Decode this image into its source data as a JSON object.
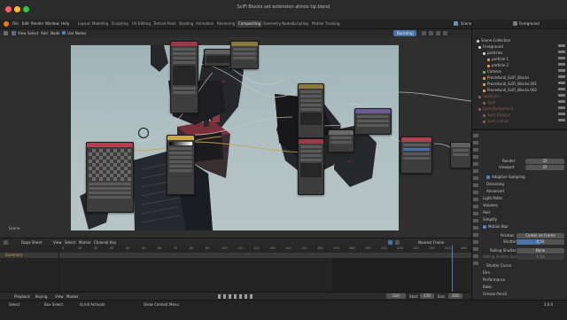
{
  "window": {
    "title": "SciFi Blocks set extension atmos tip.blend",
    "traffic_lights": [
      "#ff5f57",
      "#febc2e",
      "#28c840"
    ]
  },
  "menubar": {
    "menus": [
      "File",
      "Edit",
      "Render",
      "Window",
      "Help"
    ],
    "workspaces": [
      "Layout",
      "Modeling",
      "Sculpting",
      "UV Editing",
      "Texture Paint",
      "Shading",
      "Animation",
      "Rendering",
      "Compositing",
      "Geometry Nodes",
      "Scripting",
      "Motion Tracking"
    ],
    "active_workspace": "Compositing",
    "scene": "Scene",
    "view_layer": "Foreground"
  },
  "editor_header": {
    "items": [
      "View",
      "Select",
      "Add",
      "Node"
    ],
    "use_nodes": "Use Nodes",
    "backdrop": "Backdrop"
  },
  "outliner": {
    "title": "Scene Collection",
    "rows": [
      {
        "label": "Foreground",
        "color": "#cfcfcf"
      },
      {
        "label": "particles",
        "color": "#cfcfcf"
      },
      {
        "label": "particle 1",
        "color": "#cfcfcf"
      },
      {
        "label": "particle 2",
        "color": "#cfcfcf"
      },
      {
        "label": "Camera",
        "color": "#cfcfcf"
      },
      {
        "label": "Procedural_SciFi_Blocks",
        "color": "#cfcfcf"
      },
      {
        "label": "Procedural_SciFi_Blocks.001",
        "color": "#cfcfcf"
      },
      {
        "label": "Procedural_SciFi_Blocks.002",
        "color": "#cfcfcf"
      },
      {
        "label": "Spotlights",
        "color": "#8a5a5a"
      },
      {
        "label": "Spot",
        "color": "#8a5a5a"
      },
      {
        "label": "Spot Background",
        "color": "#8a5a5a"
      },
      {
        "label": "Spot_Emptys",
        "color": "#8a5a5a"
      },
      {
        "label": "Spot_Lamps",
        "color": "#8a5a5a"
      }
    ]
  },
  "properties": {
    "render_label": "Render",
    "render_value": "32",
    "viewport_label": "Viewport",
    "viewport_value": "32",
    "adaptive_sampling": "Adaptive Sampling",
    "denoising": "Denoising",
    "advanced": "Advanced",
    "light_paths": "Light Paths",
    "volumes": "Volumes",
    "hair": "Hair",
    "simplify": "Simplify",
    "motion_blur": "Motion Blur",
    "position_label": "Position",
    "position_value": "Center on Frame",
    "shutter_label": "Shutter",
    "shutter_value": "0.50",
    "rolling_shutter_label": "Rolling Shutter",
    "rolling_shutter_value": "None",
    "rolling_duration_label": "Rolling Shutter Dur.",
    "rolling_duration_value": "0.10",
    "shutter_curve": "Shutter Curve",
    "film": "Film",
    "performance": "Performance",
    "bake": "Bake",
    "grease_pencil": "Grease Pencil"
  },
  "timeline": {
    "mode": "Dope Sheet",
    "menus": [
      "View",
      "Select",
      "Marker",
      "Channel",
      "Key"
    ],
    "filter": "Nearest Frame",
    "summary": "Summary",
    "ticks": [
      "0",
      "10",
      "20",
      "30",
      "40",
      "50",
      "60",
      "70",
      "80",
      "90",
      "100",
      "110",
      "120",
      "130",
      "140",
      "150",
      "160",
      "170",
      "180",
      "190",
      "200",
      "210",
      "220",
      "230",
      "240",
      "250"
    ],
    "playback": "Playback",
    "keying": "Keying",
    "view": "View",
    "marker": "Marker",
    "current_frame": "310",
    "start_label": "Start",
    "start_value": "170",
    "end_label": "End",
    "end_value": "310"
  },
  "statusbar": {
    "items": [
      "Select",
      "Box Select",
      "Scroll Activate",
      "Show Context Menu"
    ],
    "version": "3.0.0"
  },
  "viewer": {
    "label": "Scene"
  }
}
